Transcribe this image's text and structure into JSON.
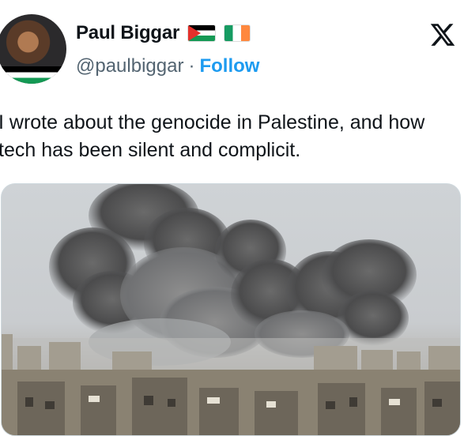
{
  "author": {
    "name": "Paul Biggar",
    "handle": "@paulbiggar",
    "separator": "·",
    "follow_label": "Follow",
    "flags": [
      "palestine-flag",
      "ireland-flag"
    ]
  },
  "brand": {
    "logo": "x-logo"
  },
  "tweet": {
    "text": "I wrote about the genocide in Palestine, and how tech has been silent and complicit."
  },
  "media": {
    "type": "photo"
  },
  "colors": {
    "follow": "#1d9bf0",
    "handle": "#536471",
    "text": "#0f1419"
  }
}
